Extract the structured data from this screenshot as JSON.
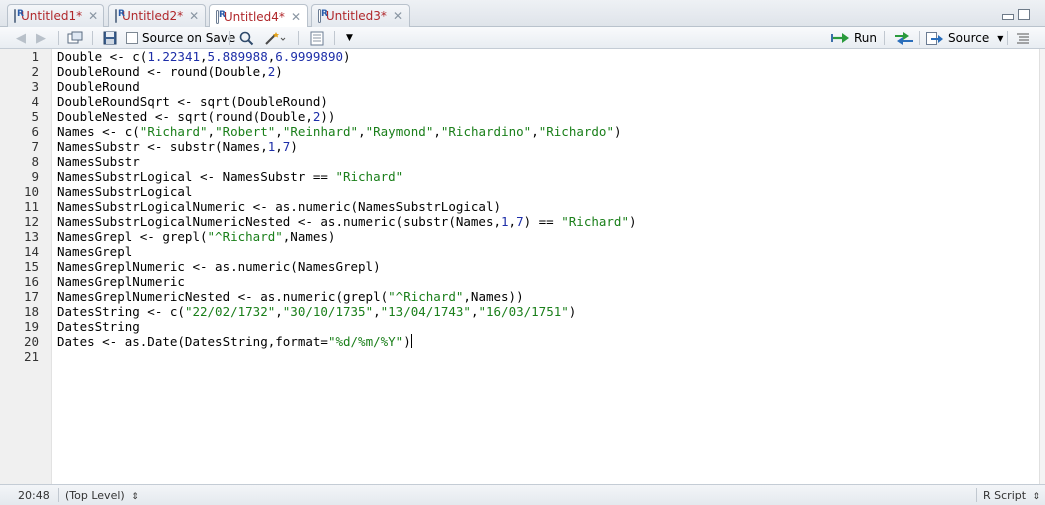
{
  "tabs": [
    {
      "label": "Untitled1*",
      "active": false
    },
    {
      "label": "Untitled2*",
      "active": false
    },
    {
      "label": "Untitled4*",
      "active": true
    },
    {
      "label": "Untitled3*",
      "active": false
    }
  ],
  "toolbar": {
    "source_on_save": "Source on Save",
    "run": "Run",
    "source": "Source"
  },
  "editor": {
    "line_numbers": [
      "1",
      "2",
      "3",
      "4",
      "5",
      "6",
      "7",
      "8",
      "9",
      "10",
      "11",
      "12",
      "13",
      "14",
      "15",
      "16",
      "17",
      "18",
      "19",
      "20",
      "21"
    ],
    "lines": [
      [
        {
          "t": "Double <- c("
        },
        {
          "t": "1.22341",
          "c": "#1d2ea8"
        },
        {
          "t": ","
        },
        {
          "t": "5.889988",
          "c": "#1d2ea8"
        },
        {
          "t": ","
        },
        {
          "t": "6.9999890",
          "c": "#1d2ea8"
        },
        {
          "t": ")"
        }
      ],
      [
        {
          "t": "DoubleRound <- round(Double,"
        },
        {
          "t": "2",
          "c": "#1d2ea8"
        },
        {
          "t": ")"
        }
      ],
      [
        {
          "t": "DoubleRound"
        }
      ],
      [
        {
          "t": "DoubleRoundSqrt <- sqrt(DoubleRound)"
        }
      ],
      [
        {
          "t": "DoubleNested <- sqrt(round(Double,"
        },
        {
          "t": "2",
          "c": "#1d2ea8"
        },
        {
          "t": "))"
        }
      ],
      [
        {
          "t": "Names <- c("
        },
        {
          "t": "\"Richard\"",
          "c": "#1a7f1a"
        },
        {
          "t": ","
        },
        {
          "t": "\"Robert\"",
          "c": "#1a7f1a"
        },
        {
          "t": ","
        },
        {
          "t": "\"Reinhard\"",
          "c": "#1a7f1a"
        },
        {
          "t": ","
        },
        {
          "t": "\"Raymond\"",
          "c": "#1a7f1a"
        },
        {
          "t": ","
        },
        {
          "t": "\"Richardino\"",
          "c": "#1a7f1a"
        },
        {
          "t": ","
        },
        {
          "t": "\"Richardo\"",
          "c": "#1a7f1a"
        },
        {
          "t": ")"
        }
      ],
      [
        {
          "t": "NamesSubstr <- substr(Names,"
        },
        {
          "t": "1",
          "c": "#1d2ea8"
        },
        {
          "t": ","
        },
        {
          "t": "7",
          "c": "#1d2ea8"
        },
        {
          "t": ")"
        }
      ],
      [
        {
          "t": "NamesSubstr"
        }
      ],
      [
        {
          "t": "NamesSubstrLogical <- NamesSubstr == "
        },
        {
          "t": "\"Richard\"",
          "c": "#1a7f1a"
        }
      ],
      [
        {
          "t": "NamesSubstrLogical"
        }
      ],
      [
        {
          "t": "NamesSubstrLogicalNumeric <- as.numeric(NamesSubstrLogical)"
        }
      ],
      [
        {
          "t": "NamesSubstrLogicalNumericNested <- as.numeric(substr(Names,"
        },
        {
          "t": "1",
          "c": "#1d2ea8"
        },
        {
          "t": ","
        },
        {
          "t": "7",
          "c": "#1d2ea8"
        },
        {
          "t": ") == "
        },
        {
          "t": "\"Richard\"",
          "c": "#1a7f1a"
        },
        {
          "t": ")"
        }
      ],
      [
        {
          "t": "NamesGrepl <- grepl("
        },
        {
          "t": "\"^Richard\"",
          "c": "#1a7f1a"
        },
        {
          "t": ",Names)"
        }
      ],
      [
        {
          "t": "NamesGrepl"
        }
      ],
      [
        {
          "t": "NamesGreplNumeric <- as.numeric(NamesGrepl)"
        }
      ],
      [
        {
          "t": "NamesGreplNumeric"
        }
      ],
      [
        {
          "t": "NamesGreplNumericNested <- as.numeric(grepl("
        },
        {
          "t": "\"^Richard\"",
          "c": "#1a7f1a"
        },
        {
          "t": ",Names))"
        }
      ],
      [
        {
          "t": "DatesString <- c("
        },
        {
          "t": "\"22/02/1732\"",
          "c": "#1a7f1a"
        },
        {
          "t": ","
        },
        {
          "t": "\"30/10/1735\"",
          "c": "#1a7f1a"
        },
        {
          "t": ","
        },
        {
          "t": "\"13/04/1743\"",
          "c": "#1a7f1a"
        },
        {
          "t": ","
        },
        {
          "t": "\"16/03/1751\"",
          "c": "#1a7f1a"
        },
        {
          "t": ")"
        }
      ],
      [
        {
          "t": "DatesString"
        }
      ],
      [
        {
          "t": "Dates <- as.Date(DatesString,format="
        },
        {
          "t": "\"%d/%m/%Y\"",
          "c": "#1a7f1a"
        },
        {
          "t": ")"
        },
        {
          "cursor": true
        }
      ],
      []
    ]
  },
  "status": {
    "position": "20:48",
    "scope": "(Top Level)",
    "file_type": "R Script"
  }
}
